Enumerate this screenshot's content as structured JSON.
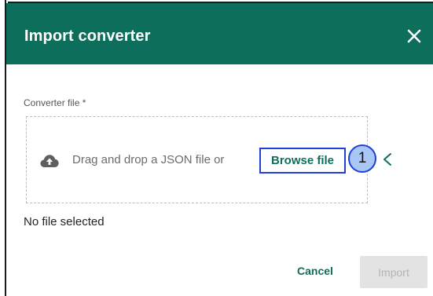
{
  "dialog": {
    "title": "Import converter",
    "close_icon": "close-icon"
  },
  "form": {
    "field_label": "Converter file *",
    "drop_text": "Drag and drop a JSON file or",
    "browse_label": "Browse file",
    "upload_icon": "cloud-upload-icon",
    "marker_label": "1",
    "status_text": "No file selected"
  },
  "actions": {
    "cancel_label": "Cancel",
    "import_label": "Import"
  },
  "colors": {
    "header": "#0d6e5b",
    "accent": "#0d6e5b",
    "highlight": "#1f3fd6",
    "marker_fill": "#a9c7f5",
    "disabled_bg": "#e3e3e3"
  }
}
